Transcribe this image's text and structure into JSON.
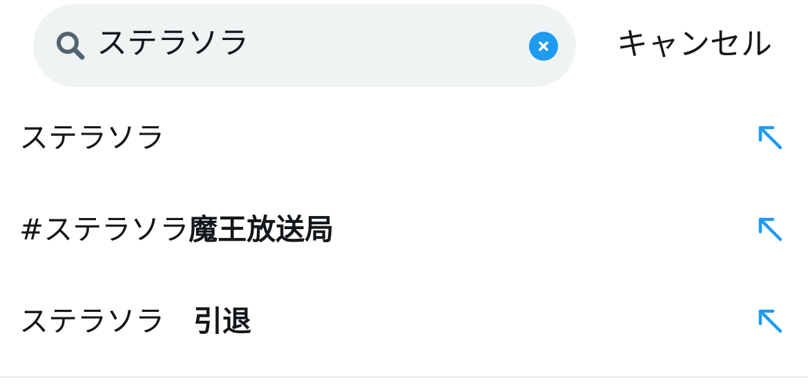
{
  "search": {
    "value": "ステラソラ",
    "placeholder": ""
  },
  "header": {
    "cancel_label": "キャンセル"
  },
  "colors": {
    "accent": "#1d9bf0",
    "search_bg": "#eff3f4",
    "text": "#14171a",
    "icon_gray": "#536471"
  },
  "icons": {
    "search": "search-icon",
    "clear": "clear-icon",
    "fill": "arrow-up-left-icon"
  },
  "suggestions": [
    {
      "match": "ステラソラ",
      "rest": ""
    },
    {
      "match": "#ステラソラ",
      "rest": "魔王放送局"
    },
    {
      "match": "ステラソラ　",
      "rest": "引退"
    }
  ]
}
